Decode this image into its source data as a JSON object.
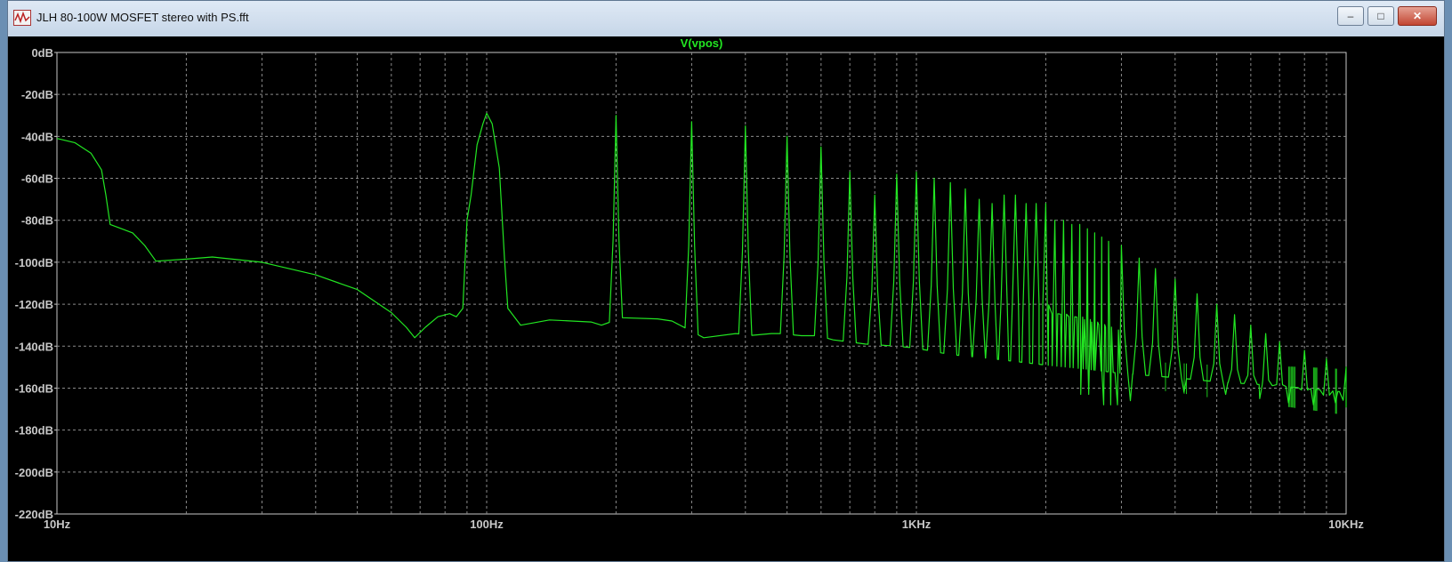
{
  "window": {
    "title": "JLH 80-100W MOSFET stereo with PS.fft",
    "minimize_label": "–",
    "restore_label": "□",
    "close_label": "✕"
  },
  "colors": {
    "trace": "#22e622",
    "grid": "#8a8a8a",
    "axis": "#c8c8c8",
    "background": "#000000"
  },
  "chart_data": {
    "type": "line",
    "title": "V(vpos)",
    "x_scale": "log",
    "xlim": [
      10,
      10000
    ],
    "ylim": [
      -220,
      0
    ],
    "x_ticks": [
      {
        "value": 10,
        "label": "10Hz"
      },
      {
        "value": 100,
        "label": "100Hz"
      },
      {
        "value": 1000,
        "label": "1KHz"
      },
      {
        "value": 10000,
        "label": "10KHz"
      }
    ],
    "y_ticks": [
      {
        "value": 0,
        "label": "0dB"
      },
      {
        "value": -20,
        "label": "-20dB"
      },
      {
        "value": -40,
        "label": "-40dB"
      },
      {
        "value": -60,
        "label": "-60dB"
      },
      {
        "value": -80,
        "label": "-80dB"
      },
      {
        "value": -100,
        "label": "-100dB"
      },
      {
        "value": -120,
        "label": "-120dB"
      },
      {
        "value": -140,
        "label": "-140dB"
      },
      {
        "value": -160,
        "label": "-160dB"
      },
      {
        "value": -180,
        "label": "-180dB"
      },
      {
        "value": -200,
        "label": "-200dB"
      },
      {
        "value": -220,
        "label": "-220dB"
      }
    ],
    "grid": true,
    "series": [
      {
        "baseline": [
          [
            10,
            -41
          ],
          [
            11,
            -43
          ],
          [
            12,
            -48
          ],
          [
            12.7,
            -56
          ],
          [
            13,
            -68
          ],
          [
            13.3,
            -82
          ],
          [
            15,
            -86
          ],
          [
            16,
            -92
          ],
          [
            17,
            -99.5
          ],
          [
            20,
            -98.5
          ],
          [
            23,
            -97.5
          ],
          [
            30,
            -100
          ],
          [
            40,
            -106
          ],
          [
            50,
            -113
          ],
          [
            60,
            -124
          ],
          [
            65,
            -131
          ],
          [
            68,
            -136
          ],
          [
            72,
            -131
          ],
          [
            77,
            -126
          ],
          [
            82,
            -124.5
          ],
          [
            85,
            -126
          ],
          [
            88,
            -122
          ],
          [
            120,
            -130
          ],
          [
            140,
            -127.5
          ],
          [
            175,
            -128.5
          ],
          [
            185,
            -130
          ],
          [
            210,
            -126
          ],
          [
            250,
            -127
          ],
          [
            270,
            -128
          ],
          [
            320,
            -136
          ],
          [
            380,
            -134
          ],
          [
            420,
            -135
          ],
          [
            460,
            -134
          ],
          [
            480,
            -134
          ],
          [
            540,
            -135
          ],
          [
            590,
            -135
          ],
          [
            640,
            -137
          ],
          [
            700,
            -138
          ],
          [
            760,
            -139
          ],
          [
            830,
            -139.5
          ],
          [
            900,
            -140
          ],
          [
            1000,
            -141
          ],
          [
            1200,
            -144
          ],
          [
            1500,
            -146
          ],
          [
            2000,
            -149
          ],
          [
            2500,
            -151
          ],
          [
            3000,
            -153
          ],
          [
            4000,
            -155
          ],
          [
            5000,
            -157
          ],
          [
            6000,
            -158
          ],
          [
            7000,
            -159
          ],
          [
            8000,
            -160
          ],
          [
            9000,
            -161
          ],
          [
            10000,
            -162
          ]
        ],
        "harmonics": [
          {
            "f": 200,
            "peak": -30
          },
          {
            "f": 300,
            "peak": -33
          },
          {
            "f": 400,
            "peak": -35
          },
          {
            "f": 500,
            "peak": -40
          },
          {
            "f": 600,
            "peak": -45
          },
          {
            "f": 700,
            "peak": -57
          },
          {
            "f": 800,
            "peak": -68
          },
          {
            "f": 900,
            "peak": -58
          },
          {
            "f": 1000,
            "peak": -57
          },
          {
            "f": 1100,
            "peak": -60
          },
          {
            "f": 1200,
            "peak": -62
          },
          {
            "f": 1300,
            "peak": -65
          },
          {
            "f": 1400,
            "peak": -70
          },
          {
            "f": 1500,
            "peak": -72
          },
          {
            "f": 1600,
            "peak": -68
          },
          {
            "f": 1700,
            "peak": -68
          },
          {
            "f": 1800,
            "peak": -72
          },
          {
            "f": 1900,
            "peak": -72
          },
          {
            "f": 2000,
            "peak": -72
          },
          {
            "f": 2100,
            "peak": -80
          },
          {
            "f": 2200,
            "peak": -80
          },
          {
            "f": 2300,
            "peak": -82
          },
          {
            "f": 2400,
            "peak": -82
          },
          {
            "f": 2500,
            "peak": -84
          },
          {
            "f": 2600,
            "peak": -86
          },
          {
            "f": 2700,
            "peak": -88
          },
          {
            "f": 2800,
            "peak": -90
          },
          {
            "f": 3000,
            "peak": -92
          },
          {
            "f": 3300,
            "peak": -98
          },
          {
            "f": 3600,
            "peak": -103
          },
          {
            "f": 4000,
            "peak": -108
          },
          {
            "f": 4500,
            "peak": -115
          },
          {
            "f": 5000,
            "peak": -120
          },
          {
            "f": 5500,
            "peak": -125
          },
          {
            "f": 6000,
            "peak": -130
          },
          {
            "f": 6500,
            "peak": -134
          },
          {
            "f": 7000,
            "peak": -138
          },
          {
            "f": 8000,
            "peak": -142
          },
          {
            "f": 9000,
            "peak": -146
          },
          {
            "f": 10000,
            "peak": -150
          }
        ],
        "fundamental": [
          [
            88,
            -122
          ],
          [
            90,
            -80
          ],
          [
            92,
            -68
          ],
          [
            95,
            -44
          ],
          [
            98,
            -34
          ],
          [
            100,
            -29
          ],
          [
            103,
            -34
          ],
          [
            107,
            -55
          ],
          [
            110,
            -98
          ],
          [
            112,
            -122
          ],
          [
            120,
            -130
          ]
        ],
        "dips": [
          {
            "f": 2350,
            "value": -163
          },
          {
            "f": 2700,
            "value": -168
          },
          {
            "f": 3000,
            "value": -166
          },
          {
            "f": 4000,
            "value": -162
          },
          {
            "f": 5000,
            "value": -163
          },
          {
            "f": 6000,
            "value": -165
          },
          {
            "f": 7000,
            "value": -167
          },
          {
            "f": 8000,
            "value": -168
          },
          {
            "f": 9000,
            "value": -167
          },
          {
            "f": 10000,
            "value": -169
          }
        ]
      }
    ]
  }
}
